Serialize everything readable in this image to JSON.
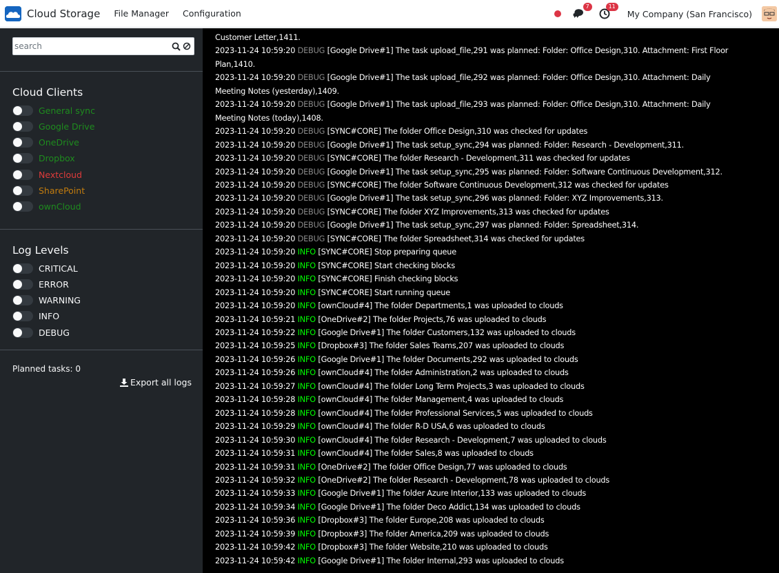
{
  "navbar": {
    "app_name": "Cloud Storage",
    "menu": [
      "File Manager",
      "Configuration"
    ],
    "messages_count": "7",
    "activities_count": "11",
    "company": "My Company (San Francisco)"
  },
  "sidebar": {
    "search_placeholder": "search",
    "cloud_clients_title": "Cloud Clients",
    "cloud_clients": [
      {
        "label": "General sync",
        "color": "#1e8c1e"
      },
      {
        "label": "Google Drive",
        "color": "#1e8c1e"
      },
      {
        "label": "OneDrive",
        "color": "#1e8c1e"
      },
      {
        "label": "Dropbox",
        "color": "#1e8c1e"
      },
      {
        "label": "Nextcloud",
        "color": "#e03b3b"
      },
      {
        "label": "SharePoint",
        "color": "#c27c0e"
      },
      {
        "label": "ownCloud",
        "color": "#1e8c1e"
      }
    ],
    "log_levels_title": "Log Levels",
    "log_levels": [
      "CRITICAL",
      "ERROR",
      "WARNING",
      "INFO",
      "DEBUG"
    ],
    "planned_tasks": "Planned tasks: 0",
    "export_label": "Export all logs"
  },
  "logs": [
    {
      "ts": "",
      "level": "",
      "msg": "Customer Letter,1411."
    },
    {
      "ts": "2023-11-24 10:59:20",
      "level": "DEBUG",
      "msg": "[Google Drive#1] The task upload_file,291 was planned: Folder: Office Design,310. Attachment: First Floor"
    },
    {
      "ts": "",
      "level": "",
      "msg": "Plan,1410."
    },
    {
      "ts": "2023-11-24 10:59:20",
      "level": "DEBUG",
      "msg": "[Google Drive#1] The task upload_file,292 was planned: Folder: Office Design,310. Attachment: Daily"
    },
    {
      "ts": "",
      "level": "",
      "msg": "Meeting Notes (yesterday),1409."
    },
    {
      "ts": "2023-11-24 10:59:20",
      "level": "DEBUG",
      "msg": "[Google Drive#1] The task upload_file,293 was planned: Folder: Office Design,310. Attachment: Daily"
    },
    {
      "ts": "",
      "level": "",
      "msg": "Meeting Notes (today),1408."
    },
    {
      "ts": "2023-11-24 10:59:20",
      "level": "DEBUG",
      "msg": "[SYNC#CORE] The folder Office Design,310 was checked for updates"
    },
    {
      "ts": "2023-11-24 10:59:20",
      "level": "DEBUG",
      "msg": "[Google Drive#1] The task setup_sync,294 was planned: Folder: Research - Development,311."
    },
    {
      "ts": "2023-11-24 10:59:20",
      "level": "DEBUG",
      "msg": "[SYNC#CORE] The folder Research - Development,311 was checked for updates"
    },
    {
      "ts": "2023-11-24 10:59:20",
      "level": "DEBUG",
      "msg": "[Google Drive#1] The task setup_sync,295 was planned: Folder: Software Continuous Development,312."
    },
    {
      "ts": "2023-11-24 10:59:20",
      "level": "DEBUG",
      "msg": "[SYNC#CORE] The folder Software Continuous Development,312 was checked for updates"
    },
    {
      "ts": "2023-11-24 10:59:20",
      "level": "DEBUG",
      "msg": "[Google Drive#1] The task setup_sync,296 was planned: Folder: XYZ Improvements,313."
    },
    {
      "ts": "2023-11-24 10:59:20",
      "level": "DEBUG",
      "msg": "[SYNC#CORE] The folder XYZ Improvements,313 was checked for updates"
    },
    {
      "ts": "2023-11-24 10:59:20",
      "level": "DEBUG",
      "msg": "[Google Drive#1] The task setup_sync,297 was planned: Folder: Spreadsheet,314."
    },
    {
      "ts": "2023-11-24 10:59:20",
      "level": "DEBUG",
      "msg": "[SYNC#CORE] The folder Spreadsheet,314 was checked for updates"
    },
    {
      "ts": "2023-11-24 10:59:20",
      "level": "INFO",
      "msg": "[SYNC#CORE] Stop preparing queue"
    },
    {
      "ts": "2023-11-24 10:59:20",
      "level": "INFO",
      "msg": "[SYNC#CORE] Start checking blocks"
    },
    {
      "ts": "2023-11-24 10:59:20",
      "level": "INFO",
      "msg": "[SYNC#CORE] Finish checking blocks"
    },
    {
      "ts": "2023-11-24 10:59:20",
      "level": "INFO",
      "msg": "[SYNC#CORE] Start running queue"
    },
    {
      "ts": "2023-11-24 10:59:20",
      "level": "INFO",
      "msg": "[ownCloud#4] The folder Departments,1 was uploaded to clouds"
    },
    {
      "ts": "2023-11-24 10:59:21",
      "level": "INFO",
      "msg": "[OneDrive#2] The folder Projects,76 was uploaded to clouds"
    },
    {
      "ts": "2023-11-24 10:59:22",
      "level": "INFO",
      "msg": "[Google Drive#1] The folder Customers,132 was uploaded to clouds"
    },
    {
      "ts": "2023-11-24 10:59:25",
      "level": "INFO",
      "msg": "[Dropbox#3] The folder Sales Teams,207 was uploaded to clouds"
    },
    {
      "ts": "2023-11-24 10:59:26",
      "level": "INFO",
      "msg": "[Google Drive#1] The folder Documents,292 was uploaded to clouds"
    },
    {
      "ts": "2023-11-24 10:59:26",
      "level": "INFO",
      "msg": "[ownCloud#4] The folder Administration,2 was uploaded to clouds"
    },
    {
      "ts": "2023-11-24 10:59:27",
      "level": "INFO",
      "msg": "[ownCloud#4] The folder Long Term Projects,3 was uploaded to clouds"
    },
    {
      "ts": "2023-11-24 10:59:28",
      "level": "INFO",
      "msg": "[ownCloud#4] The folder Management,4 was uploaded to clouds"
    },
    {
      "ts": "2023-11-24 10:59:28",
      "level": "INFO",
      "msg": "[ownCloud#4] The folder Professional Services,5 was uploaded to clouds"
    },
    {
      "ts": "2023-11-24 10:59:29",
      "level": "INFO",
      "msg": "[ownCloud#4] The folder R-D USA,6 was uploaded to clouds"
    },
    {
      "ts": "2023-11-24 10:59:30",
      "level": "INFO",
      "msg": "[ownCloud#4] The folder Research - Development,7 was uploaded to clouds"
    },
    {
      "ts": "2023-11-24 10:59:31",
      "level": "INFO",
      "msg": "[ownCloud#4] The folder Sales,8 was uploaded to clouds"
    },
    {
      "ts": "2023-11-24 10:59:31",
      "level": "INFO",
      "msg": "[OneDrive#2] The folder Office Design,77 was uploaded to clouds"
    },
    {
      "ts": "2023-11-24 10:59:32",
      "level": "INFO",
      "msg": "[OneDrive#2] The folder Research - Development,78 was uploaded to clouds"
    },
    {
      "ts": "2023-11-24 10:59:33",
      "level": "INFO",
      "msg": "[Google Drive#1] The folder Azure Interior,133 was uploaded to clouds"
    },
    {
      "ts": "2023-11-24 10:59:34",
      "level": "INFO",
      "msg": "[Google Drive#1] The folder Deco Addict,134 was uploaded to clouds"
    },
    {
      "ts": "2023-11-24 10:59:36",
      "level": "INFO",
      "msg": "[Dropbox#3] The folder Europe,208 was uploaded to clouds"
    },
    {
      "ts": "2023-11-24 10:59:39",
      "level": "INFO",
      "msg": "[Dropbox#3] The folder America,209 was uploaded to clouds"
    },
    {
      "ts": "2023-11-24 10:59:42",
      "level": "INFO",
      "msg": "[Dropbox#3] The folder Website,210 was uploaded to clouds"
    },
    {
      "ts": "2023-11-24 10:59:42",
      "level": "INFO",
      "msg": "[Google Drive#1] The folder Internal,293 was uploaded to clouds"
    }
  ]
}
